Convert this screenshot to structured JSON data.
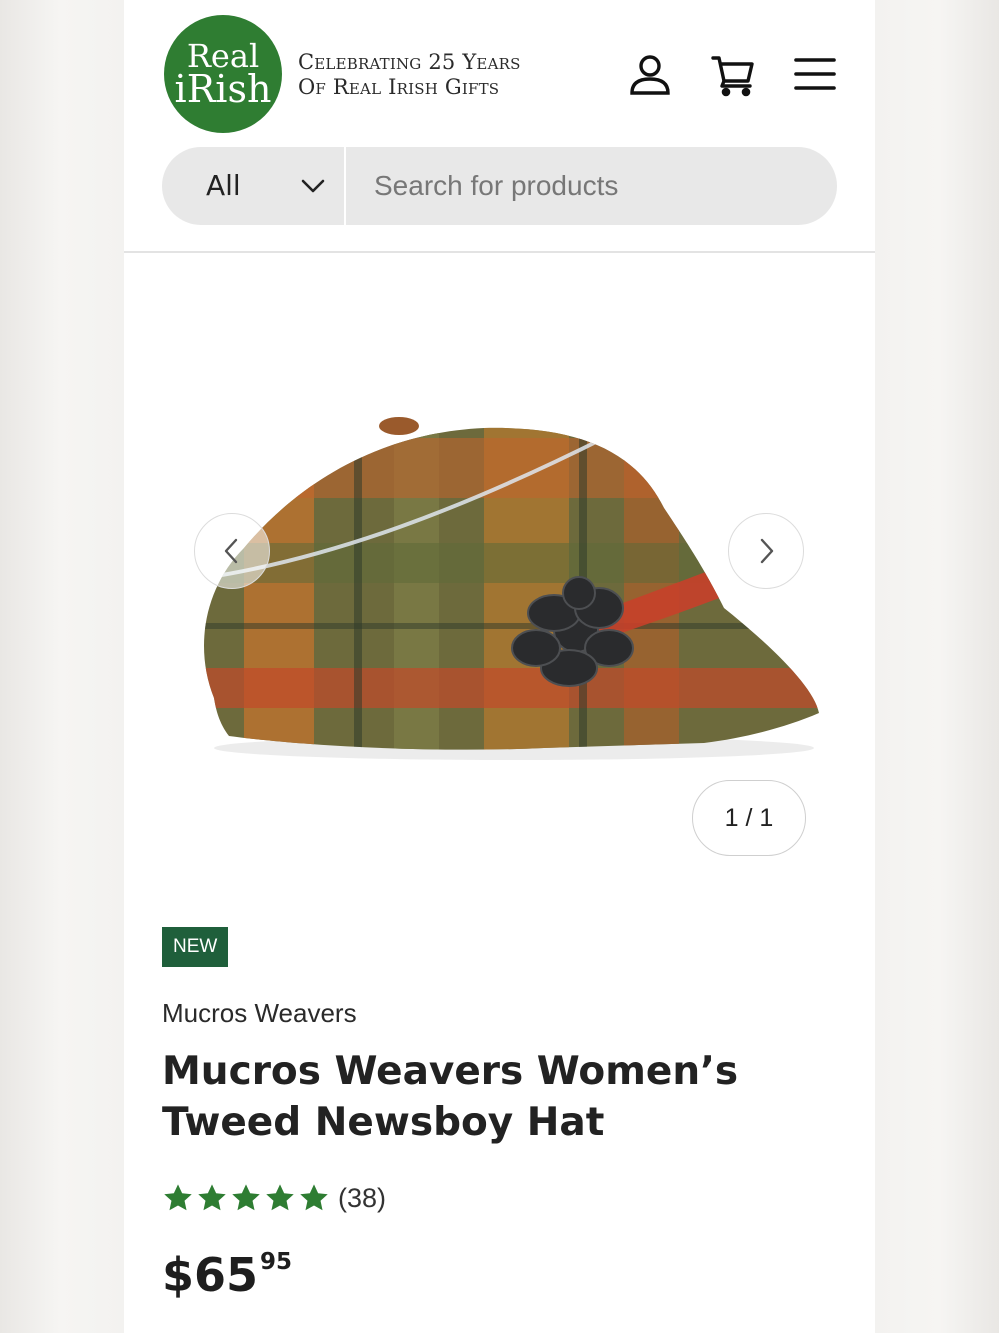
{
  "header": {
    "logo": {
      "line1": "Real",
      "line2": "iRish"
    },
    "tagline_line1": "Celebrating 25 Years",
    "tagline_line2": "Of Real Irish Gifts",
    "icons": [
      "account-icon",
      "cart-icon",
      "menu-icon"
    ]
  },
  "search": {
    "category_selected": "All",
    "placeholder": "Search for products",
    "value": ""
  },
  "gallery": {
    "image_alt": "Mucros Weavers Women's Tweed Newsboy Hat",
    "counter": "1 / 1"
  },
  "product": {
    "badge": "NEW",
    "vendor": "Mucros Weavers",
    "title": "Mucros Weavers Women’s Tweed Newsboy Hat",
    "rating": 5,
    "rating_max": 5,
    "review_count": "(38)",
    "price_main": "$65",
    "price_cents": "95"
  },
  "colors": {
    "brand_green": "#2f7d32",
    "badge_green": "#1f5f3b",
    "star_green": "#2e7d32"
  }
}
